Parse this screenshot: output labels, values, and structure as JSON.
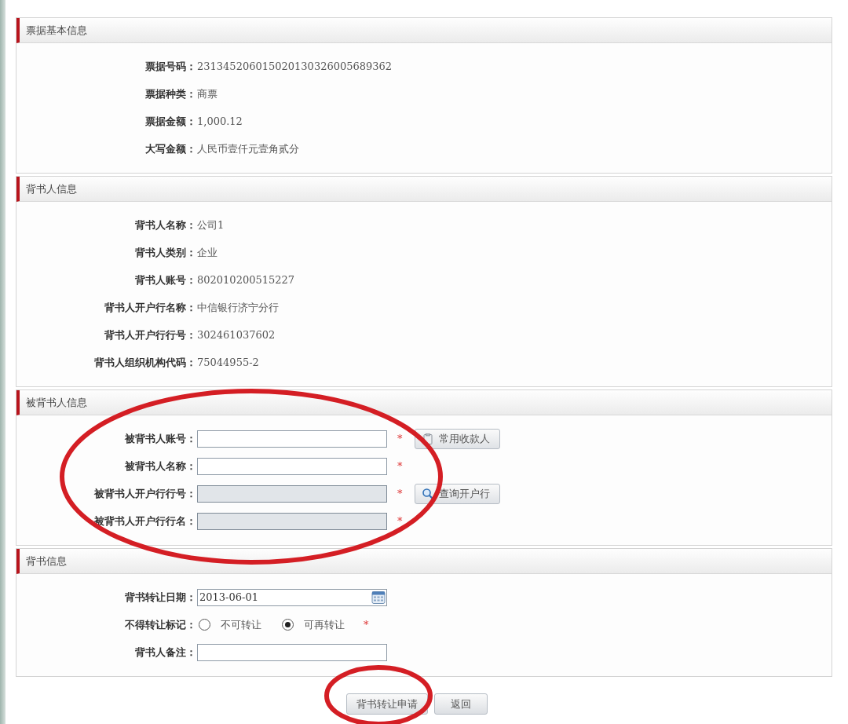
{
  "sections": [
    {
      "title": "票据基本信息",
      "rows": [
        {
          "kind": "text",
          "label": "票据号码：",
          "value": "231345206015020130326005689362"
        },
        {
          "kind": "text",
          "label": "票据种类：",
          "value": "商票"
        },
        {
          "kind": "text",
          "label": "票据金额：",
          "value": "1,000.12"
        },
        {
          "kind": "text",
          "label": "大写金额：",
          "value": "人民币壹仟元壹角贰分"
        }
      ]
    },
    {
      "title": "背书人信息",
      "rows": [
        {
          "kind": "text",
          "label": "背书人名称：",
          "value": "公司1"
        },
        {
          "kind": "text",
          "label": "背书人类别：",
          "value": "企业"
        },
        {
          "kind": "text",
          "label": "背书人账号：",
          "value": "802010200515227"
        },
        {
          "kind": "text",
          "label": "背书人开户行名称：",
          "value": "中信银行济宁分行"
        },
        {
          "kind": "text",
          "label": "背书人开户行行号：",
          "value": "302461037602"
        },
        {
          "kind": "text",
          "label": "背书人组织机构代码：",
          "value": "75044955-2"
        }
      ]
    },
    {
      "title": "被背书人信息",
      "rows": [
        {
          "kind": "field",
          "label": "被背书人账号：",
          "disabled": false,
          "required_mark": "*",
          "button": "常用收款人"
        },
        {
          "kind": "field",
          "label": "被背书人名称：",
          "disabled": false,
          "required_mark": "*"
        },
        {
          "kind": "field",
          "label": "被背书人开户行行号：",
          "disabled": true,
          "required_mark": "*",
          "button": "查询开户行"
        },
        {
          "kind": "field",
          "label": "被背书人开户行行名：",
          "disabled": true,
          "required_mark": "*"
        }
      ]
    },
    {
      "title": "背书信息",
      "rows": [
        {
          "kind": "date",
          "label": "背书转让日期：",
          "value": "2013-06-01"
        },
        {
          "kind": "radio",
          "label": "不得转让标记：",
          "required_mark": "*",
          "options": [
            {
              "label": "不可转让",
              "selected": false
            },
            {
              "label": "可再转让",
              "selected": true
            }
          ]
        },
        {
          "kind": "field",
          "label": "背书人备注：",
          "disabled": false
        }
      ]
    }
  ],
  "actions": [
    "背书转让申请",
    "返回"
  ],
  "annotations": [
    {
      "kind": "ellipse"
    },
    {
      "kind": "ellipse"
    }
  ]
}
